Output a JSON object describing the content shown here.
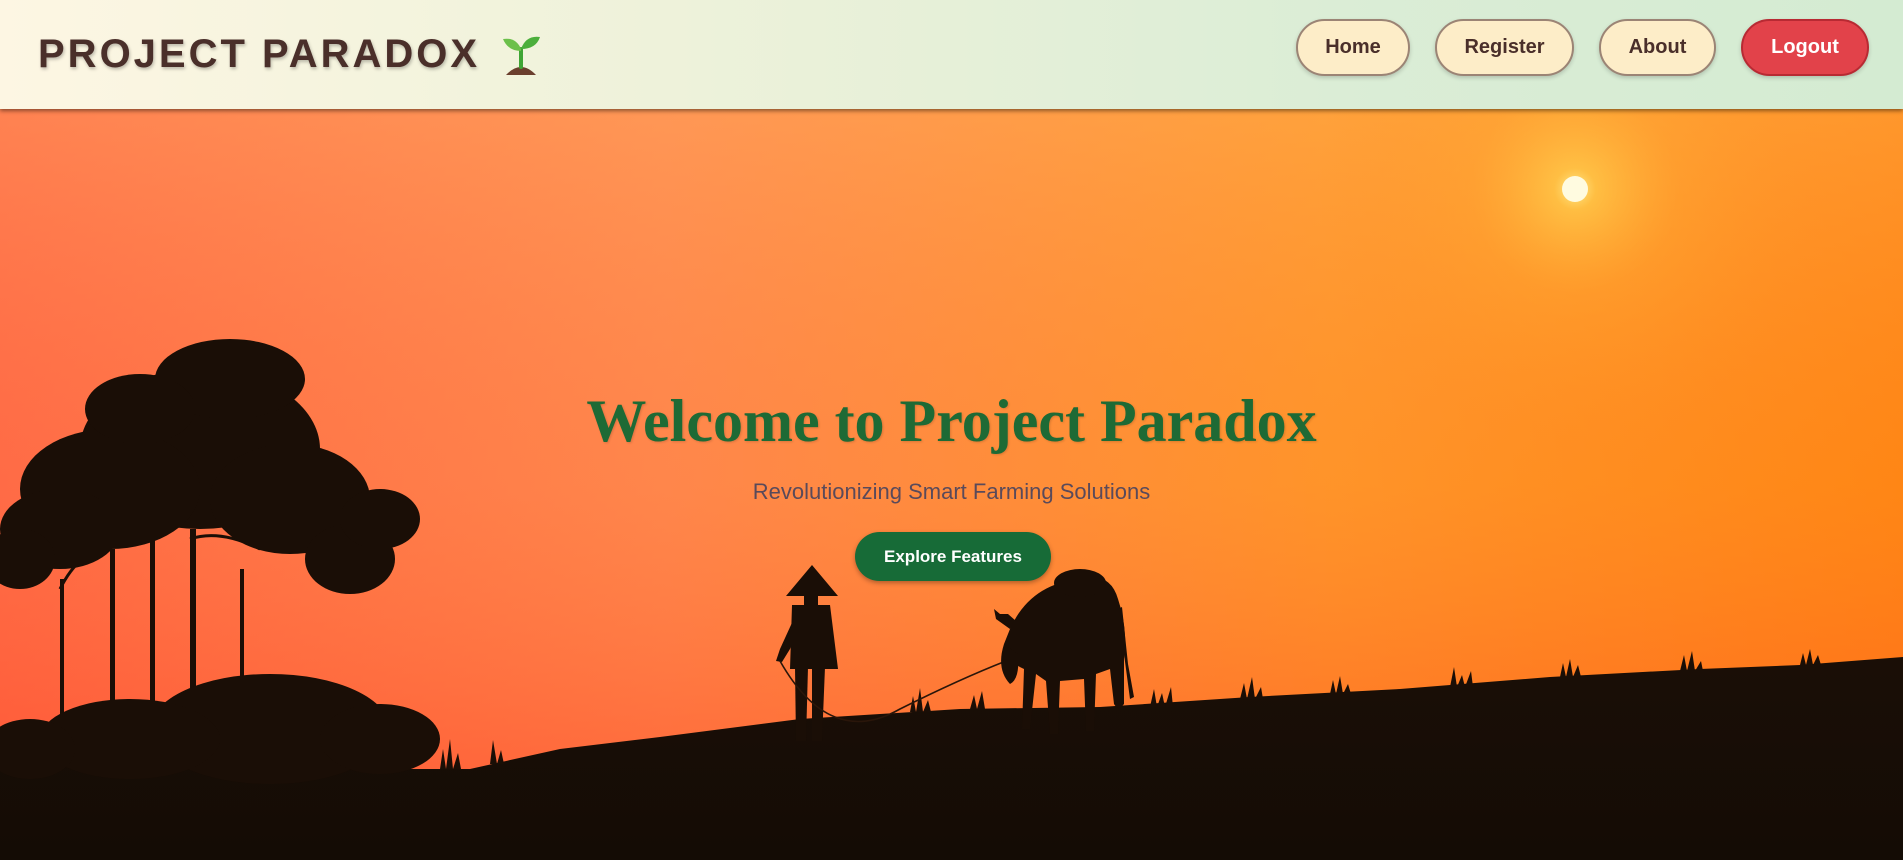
{
  "header": {
    "brand": "PROJECT PARADOX",
    "brand_icon": "sprout-icon",
    "nav": {
      "home": "Home",
      "register": "Register",
      "about": "About",
      "logout": "Logout"
    }
  },
  "hero": {
    "title": "Welcome to Project Paradox",
    "subtitle": "Revolutionizing Smart Farming Solutions",
    "cta": "Explore Features",
    "background": "sunset-farmer-with-ox-silhouette"
  },
  "colors": {
    "brand_text": "#4a2f2a",
    "nav_button_bg": "#fdedc8",
    "logout_bg": "#e2424a",
    "title_green": "#1e6a35",
    "cta_bg": "#176b37",
    "sky_orange": "#ff7a1a"
  }
}
